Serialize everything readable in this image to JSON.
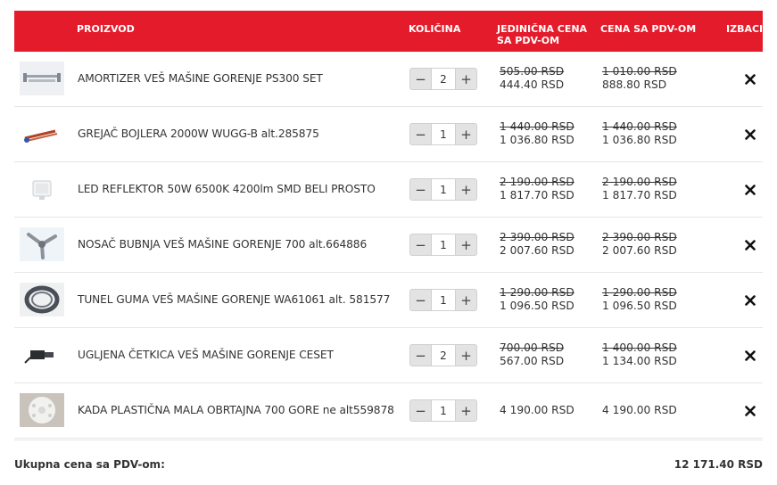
{
  "colors": {
    "header_bg": "#e41b2a",
    "header_text": "#ffffff",
    "button_bg": "#e3e3e3",
    "remove_icon": "#111111"
  },
  "header": {
    "product": "PROIZVOD",
    "quantity": "KOLIČINA",
    "unit_price": "JEDINIČNA CENA SA PDV-OM",
    "total_price": "CENA SA PDV-OM",
    "remove": "IZBACI"
  },
  "icons": {
    "decrement": "minus-icon",
    "increment": "plus-icon",
    "remove": "close-icon"
  },
  "items": [
    {
      "name": "AMORTIZER VEŠ MAŠINE GORENJE PS300 SET",
      "thumb": "shock-absorber-image",
      "quantity": "2",
      "unit_old": "505.00 RSD",
      "unit_new": "444.40 RSD",
      "total_old": "1 010.00 RSD",
      "total_new": "888.80 RSD"
    },
    {
      "name": "GREJAČ BOJLERA 2000W WUGG-B alt.285875",
      "thumb": "heater-element-image",
      "quantity": "1",
      "unit_old": "1 440.00 RSD",
      "unit_new": "1 036.80 RSD",
      "total_old": "1 440.00 RSD",
      "total_new": "1 036.80 RSD"
    },
    {
      "name": "LED REFLEKTOR 50W 6500K 4200lm SMD BELI PROSTO",
      "thumb": "led-floodlight-image",
      "quantity": "1",
      "unit_old": "2 190.00 RSD",
      "unit_new": "1 817.70 RSD",
      "total_old": "2 190.00 RSD",
      "total_new": "1 817.70 RSD"
    },
    {
      "name": "NOSAČ BUBNJA VEŠ MAŠINE GORENJE 700 alt.664886",
      "thumb": "drum-bracket-image",
      "quantity": "1",
      "unit_old": "2 390.00 RSD",
      "unit_new": "2 007.60 RSD",
      "total_old": "2 390.00 RSD",
      "total_new": "2 007.60 RSD"
    },
    {
      "name": "TUNEL GUMA VEŠ MAŠINE GORENJE WA61061 alt. 581577",
      "thumb": "door-gasket-image",
      "quantity": "1",
      "unit_old": "1 290.00 RSD",
      "unit_new": "1 096.50 RSD",
      "total_old": "1 290.00 RSD",
      "total_new": "1 096.50 RSD"
    },
    {
      "name": "UGLJENA ČETKICA VEŠ MAŠINE GORENJE CESET",
      "thumb": "carbon-brush-image",
      "quantity": "2",
      "unit_old": "700.00 RSD",
      "unit_new": "567.00 RSD",
      "total_old": "1 400.00 RSD",
      "total_new": "1 134.00 RSD"
    },
    {
      "name": "KADA PLASTIČNA MALA OBRTAJNA 700 GORE ne alt559878",
      "thumb": "plastic-tub-image",
      "quantity": "1",
      "unit_old": "",
      "unit_new": "4 190.00 RSD",
      "total_old": "",
      "total_new": "4 190.00 RSD"
    }
  ],
  "footer": {
    "label": "Ukupna cena sa PDV-om:",
    "total": "12 171.40 RSD"
  }
}
